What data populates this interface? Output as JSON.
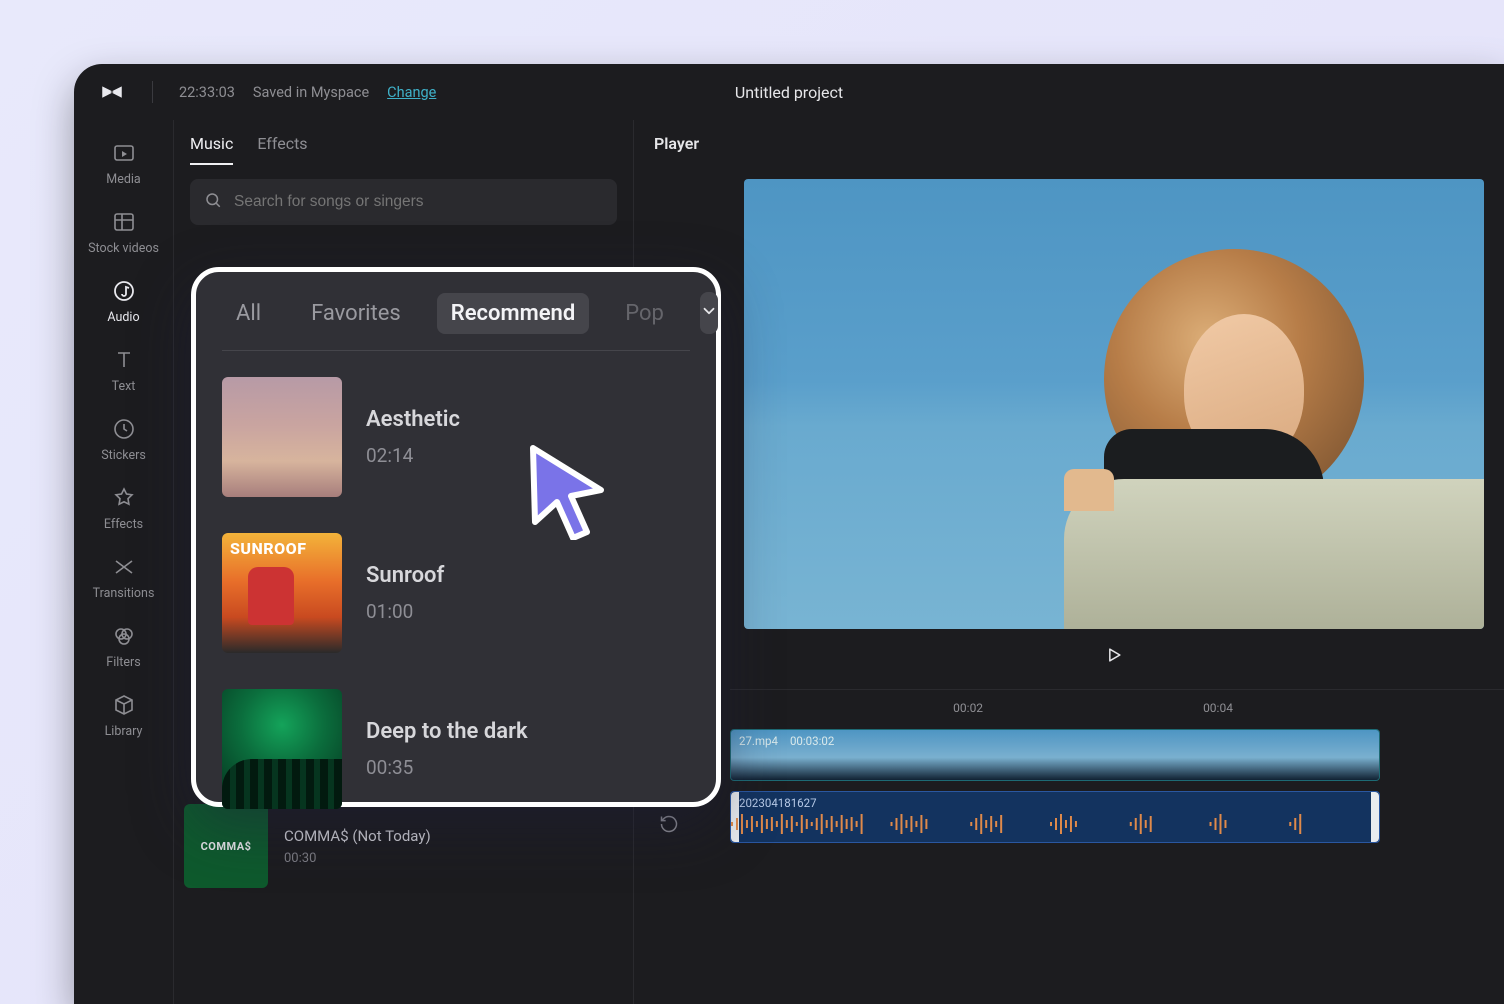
{
  "header": {
    "timestamp": "22:33:03",
    "saved_text": "Saved in Myspace",
    "change_link": "Change",
    "project_title": "Untitled project"
  },
  "rail": {
    "items": [
      {
        "label": "Media"
      },
      {
        "label": "Stock videos"
      },
      {
        "label": "Audio"
      },
      {
        "label": "Text"
      },
      {
        "label": "Stickers"
      },
      {
        "label": "Effects"
      },
      {
        "label": "Transitions"
      },
      {
        "label": "Filters"
      },
      {
        "label": "Library"
      }
    ]
  },
  "panel": {
    "tabs": {
      "music": "Music",
      "effects": "Effects"
    },
    "search_placeholder": "Search for songs or singers"
  },
  "popup": {
    "tabs": {
      "all": "All",
      "favorites": "Favorites",
      "recommend": "Recommend",
      "pop": "Pop"
    },
    "songs": [
      {
        "title": "Aesthetic",
        "duration": "02:14"
      },
      {
        "title": "Sunroof",
        "duration": "01:00"
      },
      {
        "title": "Deep to the dark",
        "duration": "00:35"
      }
    ]
  },
  "hidden_song": {
    "thumb_text": "COMMA$",
    "title": "COMMA$ (Not Today)",
    "duration": "00:30"
  },
  "player": {
    "label": "Player"
  },
  "timeline": {
    "ticks": [
      "00:02",
      "00:04"
    ],
    "video_clip": {
      "filename_suffix": "27.mp4",
      "duration": "00:03:02"
    },
    "audio_clip": {
      "name": "202304181627"
    }
  }
}
